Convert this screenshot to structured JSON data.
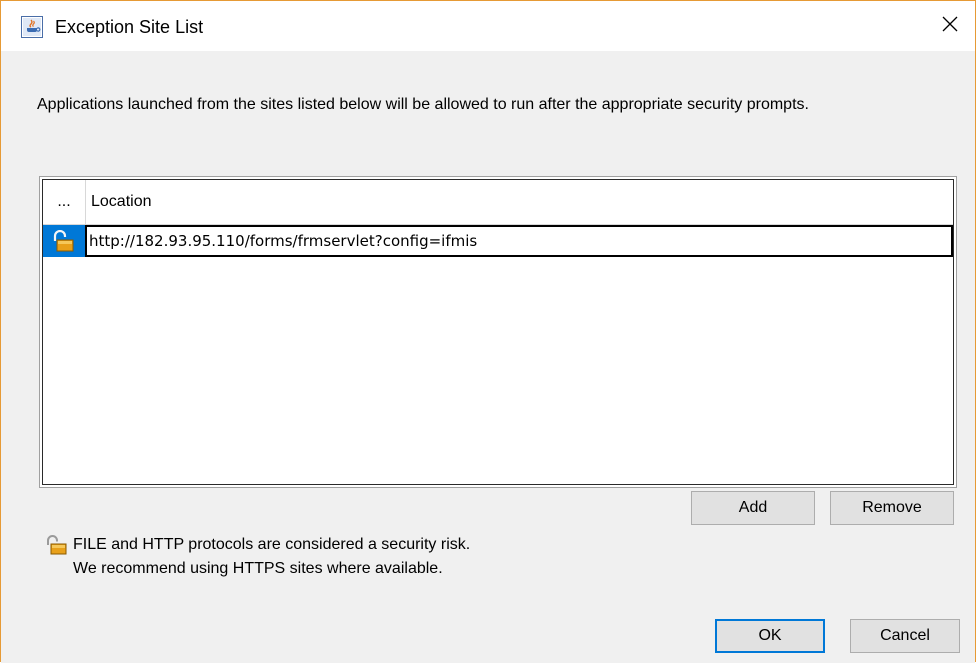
{
  "window": {
    "title": "Exception Site List"
  },
  "description": "Applications launched from the sites listed below will be allowed to run after the appropriate security prompts.",
  "table": {
    "columns": [
      "...",
      "Location"
    ],
    "rows": [
      {
        "icon": "unlocked-padlock-icon",
        "location": "http://182.93.95.110/forms/frmservlet?config=ifmis",
        "selected": true,
        "editing": true
      }
    ]
  },
  "buttons": {
    "add": "Add",
    "remove": "Remove",
    "ok": "OK",
    "cancel": "Cancel"
  },
  "warning": {
    "icon": "unlocked-padlock-icon",
    "line1": "FILE and HTTP protocols are considered a security risk.",
    "line2": "We recommend using HTTPS sites where available."
  },
  "colors": {
    "accent": "#0078d7",
    "border": "#e69a35",
    "padlock": "#e8a01a"
  }
}
